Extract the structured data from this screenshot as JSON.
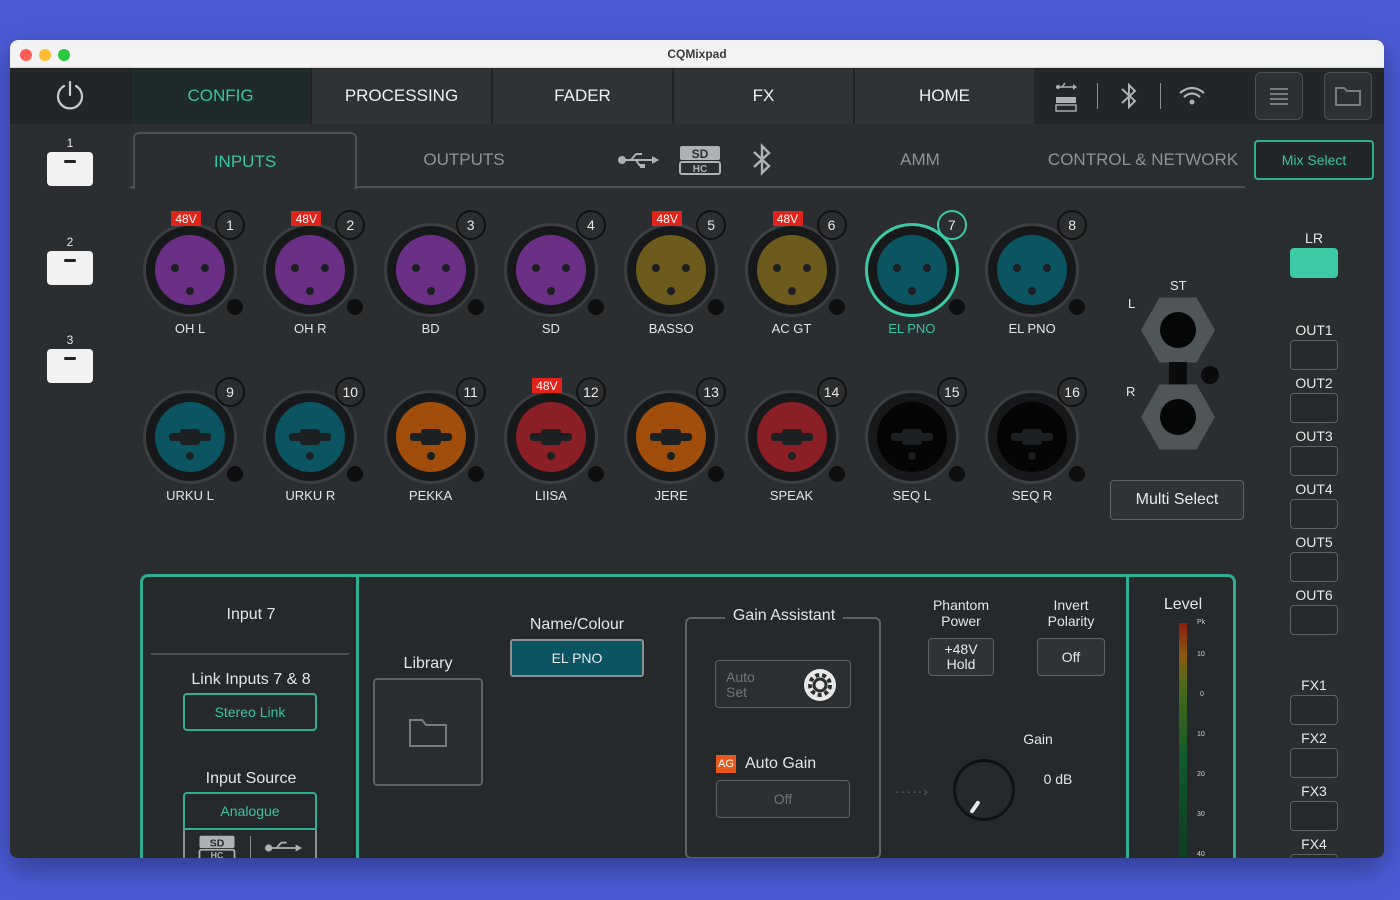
{
  "window": {
    "title": "CQMixpad"
  },
  "topbar": {
    "tabs": [
      {
        "label": "CONFIG",
        "active": true
      },
      {
        "label": "PROCESSING",
        "active": false
      },
      {
        "label": "FADER",
        "active": false
      },
      {
        "label": "FX",
        "active": false
      },
      {
        "label": "HOME",
        "active": false
      }
    ],
    "icons": [
      "power-icon",
      "usb-sd-icon",
      "bluetooth-icon",
      "wifi-icon",
      "menu-icon",
      "folder-icon"
    ]
  },
  "scenes": [
    {
      "num": "1"
    },
    {
      "num": "2"
    },
    {
      "num": "3"
    }
  ],
  "subtabs": {
    "inputs": "INPUTS",
    "outputs": "OUTPUTS",
    "amm": "AMM",
    "control_network": "CONTROL & NETWORK"
  },
  "channels": [
    {
      "num": "1",
      "name": "OH L",
      "phantom": "48V",
      "type": "xlr",
      "color": "#6c2f86"
    },
    {
      "num": "2",
      "name": "OH R",
      "phantom": "48V",
      "type": "xlr",
      "color": "#6c2f86"
    },
    {
      "num": "3",
      "name": "BD",
      "phantom": "",
      "type": "xlr",
      "color": "#6c2f86"
    },
    {
      "num": "4",
      "name": "SD",
      "phantom": "",
      "type": "xlr",
      "color": "#6c2f86"
    },
    {
      "num": "5",
      "name": "BASSO",
      "phantom": "48V",
      "type": "xlr",
      "color": "#6d5a1d"
    },
    {
      "num": "6",
      "name": "AC GT",
      "phantom": "48V",
      "type": "xlr",
      "color": "#6d5a1d"
    },
    {
      "num": "7",
      "name": "EL PNO",
      "phantom": "",
      "type": "xlr",
      "color": "#0b5563",
      "selected": true
    },
    {
      "num": "8",
      "name": "EL PNO",
      "phantom": "",
      "type": "xlr",
      "color": "#0b5563"
    },
    {
      "num": "9",
      "name": "URKU L",
      "phantom": "",
      "type": "combo",
      "color": "#0b5563"
    },
    {
      "num": "10",
      "name": "URKU R",
      "phantom": "",
      "type": "combo",
      "color": "#0b5563"
    },
    {
      "num": "11",
      "name": "PEKKA",
      "phantom": "",
      "type": "combo",
      "color": "#a14d0c"
    },
    {
      "num": "12",
      "name": "LIISA",
      "phantom": "48V",
      "type": "combo",
      "color": "#8b1f26"
    },
    {
      "num": "13",
      "name": "JERE",
      "phantom": "",
      "type": "combo",
      "color": "#a14d0c"
    },
    {
      "num": "14",
      "name": "SPEAK",
      "phantom": "",
      "type": "combo",
      "color": "#8b1f26"
    },
    {
      "num": "15",
      "name": "SEQ L",
      "phantom": "",
      "type": "combo",
      "color": "#050505"
    },
    {
      "num": "16",
      "name": "SEQ R",
      "phantom": "",
      "type": "combo",
      "color": "#050505"
    }
  ],
  "stereo": {
    "label": "ST",
    "left": "L",
    "right": "R"
  },
  "multi_select": "Multi Select",
  "panel": {
    "input_title": "Input 7",
    "link_label": "Link Inputs 7 & 8",
    "stereo_link": "Stereo Link",
    "source_label": "Input Source",
    "source_value": "Analogue",
    "library_label": "Library",
    "name_colour_label": "Name/Colour",
    "name_value": "EL PNO",
    "gain_assistant_label": "Gain Assistant",
    "auto_set": "Auto Set",
    "ag_badge": "AG",
    "auto_gain_label": "Auto Gain",
    "auto_gain_value": "Off",
    "phantom_label": "Phantom Power",
    "phantom_value": "+48V Hold",
    "invert_label": "Invert Polarity",
    "invert_value": "Off",
    "gain_label": "Gain",
    "gain_value": "0 dB",
    "level_label": "Level",
    "meter_scale": [
      "Pk",
      "10",
      "0",
      "10",
      "20",
      "30",
      "40"
    ]
  },
  "mix": {
    "select_label": "Mix Select",
    "buses": [
      {
        "label": "LR",
        "on": true
      },
      {
        "label": "OUT1",
        "on": false
      },
      {
        "label": "OUT2",
        "on": false
      },
      {
        "label": "OUT3",
        "on": false
      },
      {
        "label": "OUT4",
        "on": false
      },
      {
        "label": "OUT5",
        "on": false
      },
      {
        "label": "OUT6",
        "on": false
      },
      {
        "label": "FX1",
        "on": false
      },
      {
        "label": "FX2",
        "on": false
      },
      {
        "label": "FX3",
        "on": false
      },
      {
        "label": "FX4",
        "on": false
      }
    ]
  },
  "colors": {
    "accent": "#39c4a3",
    "panel_border": "#2fae93",
    "phantom_red": "#e0241b",
    "background": "#2a2e31",
    "ag_orange": "#e8581a"
  }
}
